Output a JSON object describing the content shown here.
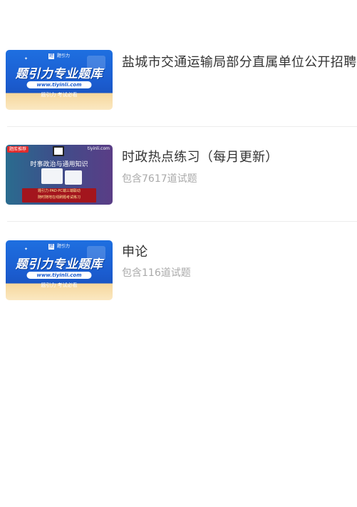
{
  "items": [
    {
      "title": "盐城市交通运输局部分直属单位公开招聘",
      "subtitle": "",
      "thumbnail": {
        "brand": "题引力",
        "headline": "题引力专业题库",
        "url": "www.tiyinli.com",
        "tagline": "题引力 考试必看"
      }
    },
    {
      "title": "时政热点练习（每月更新）",
      "subtitle": "包含7617道试题",
      "thumbnail": {
        "badge": "题库推荐",
        "site": "tiyinli.com",
        "heading": "时事政治与通用知识",
        "banner_line1": "题引力·PAD·PC端三端联动",
        "banner_line2": "随时随地在线刷题考试练习"
      }
    },
    {
      "title": "申论",
      "subtitle": "包含116道试题",
      "thumbnail": {
        "brand": "题引力",
        "headline": "题引力专业题库",
        "url": "www.tiyinli.com",
        "tagline": "题引力 考试必看"
      }
    }
  ],
  "colors": {
    "title": "#333333",
    "subtitle": "#aaaaaa",
    "divider": "#ececec",
    "thumb_blue": "#1b5ccf",
    "thumb_gold": "#f6d79b"
  }
}
